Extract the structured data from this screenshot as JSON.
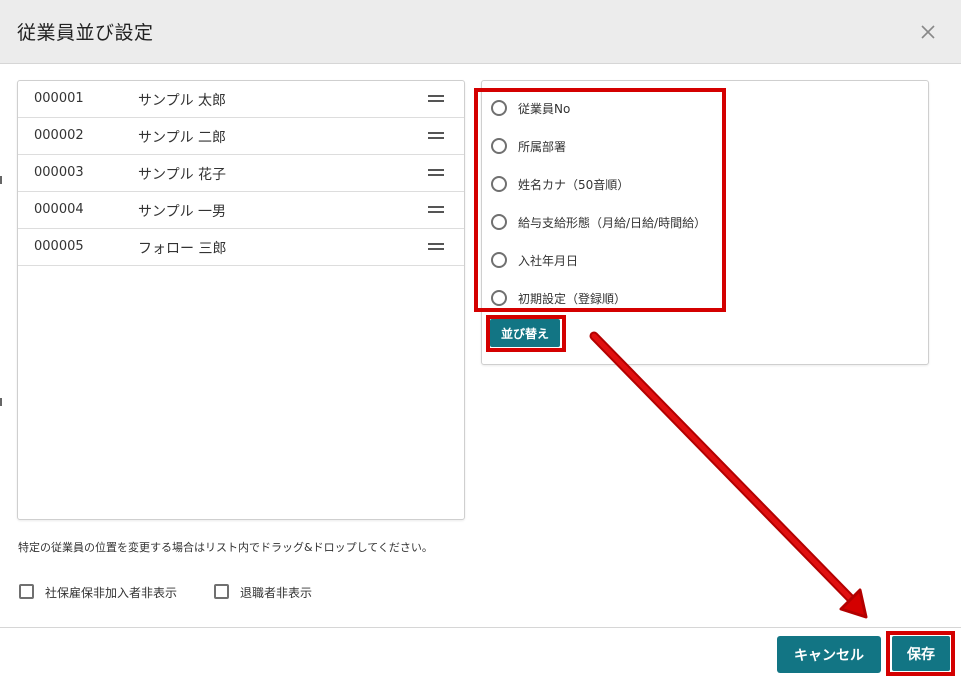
{
  "dialog": {
    "title": "従業員並び設定",
    "close_icon": "close-icon"
  },
  "employees": [
    {
      "id": "000001",
      "name": "サンプル 太郎"
    },
    {
      "id": "000002",
      "name": "サンプル 二郎"
    },
    {
      "id": "000003",
      "name": "サンプル 花子"
    },
    {
      "id": "000004",
      "name": "サンプル 一男"
    },
    {
      "id": "000005",
      "name": "フォロー 三郎"
    }
  ],
  "sort_options": [
    {
      "label": "従業員No",
      "selected": false
    },
    {
      "label": "所属部署",
      "selected": false
    },
    {
      "label": "姓名カナ（50音順）",
      "selected": false
    },
    {
      "label": "給与支給形態（月給/日給/時間給）",
      "selected": false
    },
    {
      "label": "入社年月日",
      "selected": false
    },
    {
      "label": "初期設定（登録順）",
      "selected": false
    }
  ],
  "sort_button": "並び替え",
  "hint": "特定の従業員の位置を変更する場合はリスト内でドラッグ&ドロップしてください。",
  "filters": [
    {
      "label": "社保雇保非加入者非表示",
      "checked": false
    },
    {
      "label": "退職者非表示",
      "checked": false
    }
  ],
  "footer": {
    "cancel_label": "キャンセル",
    "save_label": "保存"
  },
  "colors": {
    "accent": "#127584",
    "highlight": "#d40000"
  }
}
